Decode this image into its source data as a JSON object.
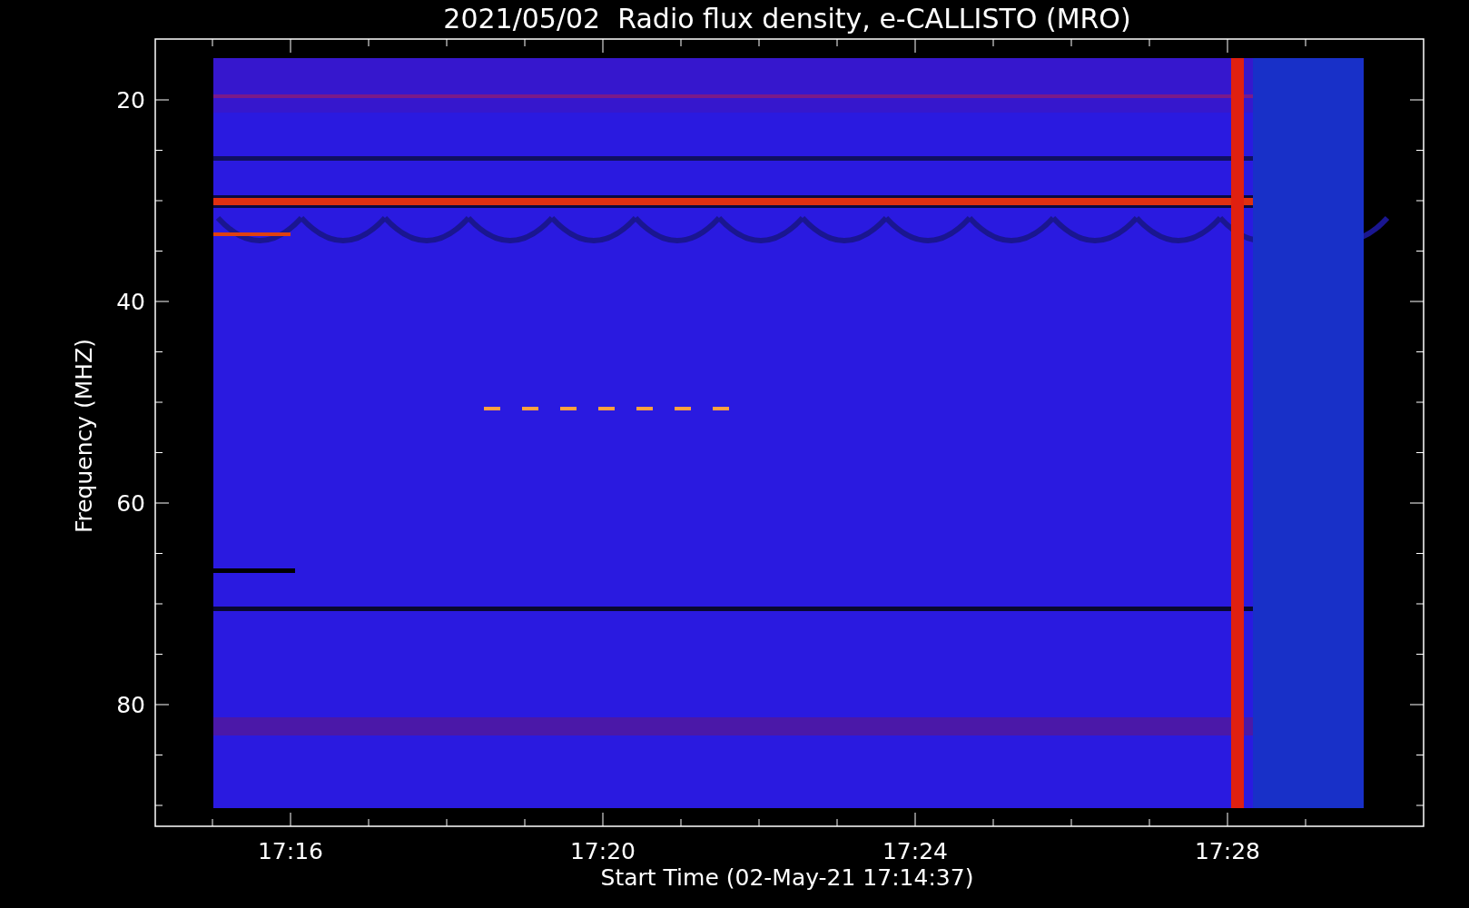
{
  "title": "2021/05/02  Radio flux density, e-CALLISTO (MRO)",
  "y_axis": {
    "label": "Frequency (MHZ)",
    "ticks": [
      "20",
      "40",
      "60",
      "80"
    ]
  },
  "x_axis": {
    "label": "Start Time (02-May-21 17:14:37)",
    "ticks": [
      "17:16",
      "17:20",
      "17:24",
      "17:28"
    ]
  }
}
